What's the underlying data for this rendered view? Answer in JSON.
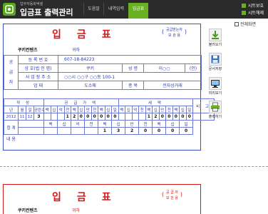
{
  "app": {
    "subtitle": "업무자동화엑셀",
    "title": "입금표 출력관리",
    "nav": [
      "도움말",
      "내역입력",
      "입금표"
    ],
    "top_links": [
      "시트보호",
      "시트해제"
    ],
    "fullscreen_label": "전체화면"
  },
  "invoice": {
    "title": "입금표",
    "copy_note_line1": "공급받는자",
    "copy_note_line2": "보 관 용",
    "buyer_name": "쿠키컨텐츠",
    "buyer_suffix": "귀하",
    "supplier_side_label": [
      "공",
      "급",
      "자"
    ],
    "rows": {
      "reg_no_label": "등 록 번 호",
      "reg_no": "607-18-84223",
      "company_label": "상 호(법 인 명)",
      "company": "쿠키",
      "name_label": "성 명",
      "name": "이○○",
      "seal": "(인)",
      "address_label": "사 업 장 주 소",
      "address": "○○시 ○○구 ○○동 100-1",
      "biz_type_label": "업 태",
      "biz_type": "도소매",
      "biz_item_label": "종 목",
      "biz_item": "전자상거래"
    },
    "amount_header": [
      "작 성",
      "공 급 가 액",
      "세 액",
      "비 고"
    ],
    "date_header": [
      "년",
      "월",
      "일",
      "공란수"
    ],
    "digit_header": [
      "백",
      "십",
      "억",
      "천",
      "백",
      "십",
      "만",
      "천",
      "백",
      "십",
      "일"
    ],
    "date": [
      "2012",
      "11",
      "12"
    ],
    "blank_count": "3",
    "supply_digits": [
      "",
      "",
      "",
      "1",
      "2",
      "0",
      "0",
      "0",
      "0",
      "0",
      "0"
    ],
    "tax_digits": [
      "",
      "",
      "",
      "",
      "1",
      "2",
      "0",
      "0",
      "0",
      "0",
      "0"
    ],
    "total_label": "합 계",
    "total_units": [
      "백",
      "십",
      "억",
      "천",
      "백",
      "십",
      "만",
      "천",
      "백",
      "십",
      "일"
    ],
    "total_digits": [
      "",
      "",
      "",
      "",
      "1",
      "3",
      "2",
      "0",
      "0",
      "0",
      "0"
    ],
    "remarks_label": "내 용"
  },
  "side_buttons": [
    "불러오기",
    "문서저장",
    "미리보기",
    "출력하기"
  ],
  "invoice2": {
    "title": "입금표",
    "copy_note_line1": "공 급 자",
    "copy_note_line2": "보 관 용",
    "buyer_name": "쿠키컨텐츠",
    "buyer_suffix": "귀하"
  },
  "colors": {
    "accent": "#6ab023",
    "invoice_blue": "#2a3ab8",
    "title_red": "#d51a1a",
    "topbar": "#2b2b2b"
  }
}
